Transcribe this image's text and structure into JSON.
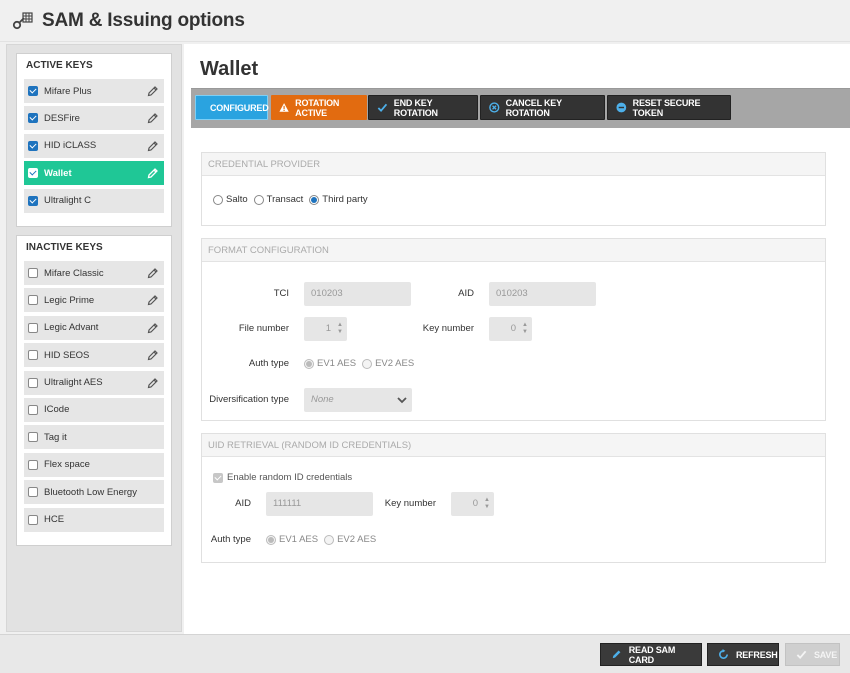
{
  "app": {
    "title": "SAM & Issuing options",
    "icon": "key-grid-icon"
  },
  "sidebar": {
    "active_title": "ACTIVE KEYS",
    "active_keys": [
      {
        "label": "Mifare Plus",
        "checked": true,
        "editable": true,
        "selected": false
      },
      {
        "label": "DESFire",
        "checked": true,
        "editable": true,
        "selected": false
      },
      {
        "label": "HID iCLASS",
        "checked": true,
        "editable": true,
        "selected": false
      },
      {
        "label": "Wallet",
        "checked": true,
        "editable": true,
        "selected": true
      },
      {
        "label": "Ultralight C",
        "checked": true,
        "editable": false,
        "selected": false
      }
    ],
    "inactive_title": "INACTIVE KEYS",
    "inactive_keys": [
      {
        "label": "Mifare Classic",
        "checked": false,
        "editable": true
      },
      {
        "label": "Legic Prime",
        "checked": false,
        "editable": true
      },
      {
        "label": "Legic Advant",
        "checked": false,
        "editable": true
      },
      {
        "label": "HID SEOS",
        "checked": false,
        "editable": true
      },
      {
        "label": "Ultralight AES",
        "checked": false,
        "editable": true
      },
      {
        "label": "ICode",
        "checked": false,
        "editable": false
      },
      {
        "label": "Tag it",
        "checked": false,
        "editable": false
      },
      {
        "label": "Flex space",
        "checked": false,
        "editable": false
      },
      {
        "label": "Bluetooth Low Energy",
        "checked": false,
        "editable": false
      },
      {
        "label": "HCE",
        "checked": false,
        "editable": false
      }
    ]
  },
  "main": {
    "title": "Wallet",
    "toolbar": {
      "configured": "CONFIGURED",
      "rotation_active": "ROTATION ACTIVE",
      "end_key_rotation": "END KEY ROTATION",
      "cancel_key_rotation": "CANCEL KEY ROTATION",
      "reset_secure_token": "RESET SECURE TOKEN"
    },
    "credential_provider": {
      "title": "CREDENTIAL PROVIDER",
      "options": [
        "Salto",
        "Transact",
        "Third party"
      ],
      "selected": "Third party"
    },
    "format_configuration": {
      "title": "FORMAT CONFIGURATION",
      "tci_label": "TCI",
      "tci_value": "010203",
      "aid_label": "AID",
      "aid_value": "010203",
      "file_number_label": "File number",
      "file_number_value": "1",
      "key_number_label": "Key number",
      "key_number_value": "0",
      "auth_type_label": "Auth type",
      "auth_options": [
        "EV1 AES",
        "EV2 AES"
      ],
      "auth_selected": "EV1 AES",
      "diversification_label": "Diversification type",
      "diversification_value": "None"
    },
    "uid_retrieval": {
      "title": "UID RETRIEVAL (RANDOM ID CREDENTIALS)",
      "enable_label": "Enable random ID credentials",
      "enabled": true,
      "aid_label": "AID",
      "aid_value": "111111",
      "key_number_label": "Key number",
      "key_number_value": "0",
      "auth_type_label": "Auth type",
      "auth_options": [
        "EV1 AES",
        "EV2 AES"
      ],
      "auth_selected": "EV1 AES"
    }
  },
  "footer": {
    "read_sam_card": "READ SAM CARD",
    "refresh": "REFRESH",
    "save": "SAVE"
  },
  "colors": {
    "selected_key": "#1fc796",
    "configured": "#2aa3e0",
    "rotation_active": "#e26b10",
    "dark_button": "#333333"
  }
}
